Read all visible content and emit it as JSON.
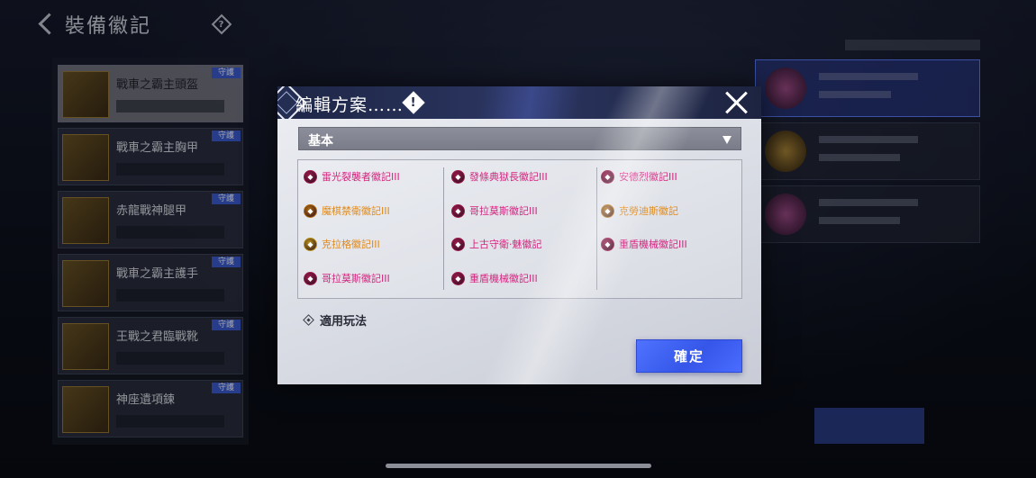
{
  "background": {
    "page_title": "裝備徽記",
    "list_items": [
      {
        "name": "戰車之霸主頭盔",
        "badge": "守護",
        "active": true
      },
      {
        "name": "戰車之霸主胸甲",
        "badge": "守護",
        "active": false
      },
      {
        "name": "赤龍戰神腿甲",
        "badge": "守護",
        "active": false
      },
      {
        "name": "戰車之霸主護手",
        "badge": "守護",
        "active": false
      },
      {
        "name": "王戰之君臨戰靴",
        "badge": "守護",
        "active": false
      },
      {
        "name": "神座遺項鍊",
        "badge": "守護",
        "active": false
      }
    ]
  },
  "modal": {
    "title": "編輯方案……",
    "warn_symbol": "!",
    "dropdown_value": "基本",
    "badges": [
      {
        "name": "雷光裂襲者徽記III",
        "color": "#d4257e",
        "icon_color": "#9c1a4d"
      },
      {
        "name": "魔棋禁衛徽記III",
        "color": "#e08a1c",
        "icon_color": "#b06a12"
      },
      {
        "name": "克拉格徽記III",
        "color": "#e08a1c",
        "icon_color": "#b8901c"
      },
      {
        "name": "哥拉莫斯徽記III",
        "color": "#d4257e",
        "icon_color": "#9c1a4d"
      },
      {
        "name": "發條典獄長徽記III",
        "color": "#d4257e",
        "icon_color": "#9c1a4d"
      },
      {
        "name": "哥拉莫斯徽記III",
        "color": "#d4257e",
        "icon_color": "#9c1a4d"
      },
      {
        "name": "上古守衛·魅徽記",
        "color": "#d4257e",
        "icon_color": "#9c1a4d"
      },
      {
        "name": "重盾機械徽記III",
        "color": "#d4257e",
        "icon_color": "#9c1a4d"
      },
      {
        "name": "安德烈徽記III",
        "color": "#d4257e",
        "icon_color": "#9c1a4d"
      },
      {
        "name": "克勞迪斯徽記",
        "color": "#e08a1c",
        "icon_color": "#b06a12"
      },
      {
        "name": "重盾機械徽記III",
        "color": "#d4257e",
        "icon_color": "#9c1a4d"
      }
    ],
    "mode_label": "適用玩法",
    "confirm_label": "確定"
  }
}
